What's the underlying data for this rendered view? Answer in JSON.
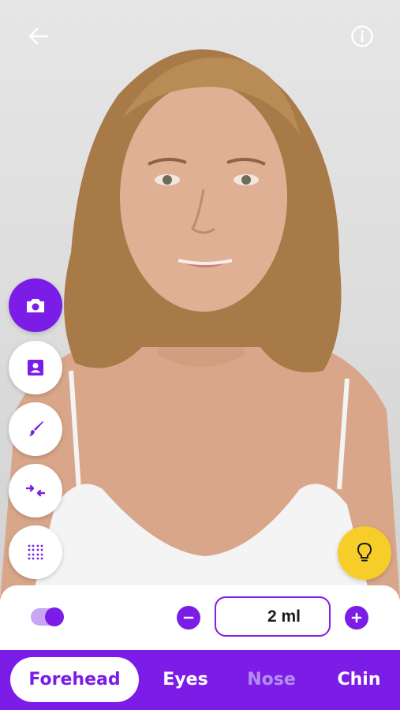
{
  "colors": {
    "accent": "#7b1de6",
    "tip": "#f7cd2a",
    "disabled_tab": "#b48df0"
  },
  "header": {
    "back_icon": "arrow-left-icon",
    "info_icon": "info-icon"
  },
  "tools": [
    {
      "name": "camera",
      "icon": "camera-icon",
      "active": true
    },
    {
      "name": "portrait",
      "icon": "portrait-icon",
      "active": false
    },
    {
      "name": "brush",
      "icon": "brush-icon",
      "active": false
    },
    {
      "name": "compare",
      "icon": "compare-arrows-icon",
      "active": false
    },
    {
      "name": "dots",
      "icon": "dot-grid-icon",
      "active": false
    }
  ],
  "tip_icon": "lightbulb-icon",
  "controls": {
    "toggle_on": true,
    "quantity": "2 ml"
  },
  "tabs": [
    {
      "label": "Forehead",
      "selected": true,
      "enabled": true
    },
    {
      "label": "Eyes",
      "selected": false,
      "enabled": true
    },
    {
      "label": "Nose",
      "selected": false,
      "enabled": false
    },
    {
      "label": "Chin",
      "selected": false,
      "enabled": true
    }
  ]
}
